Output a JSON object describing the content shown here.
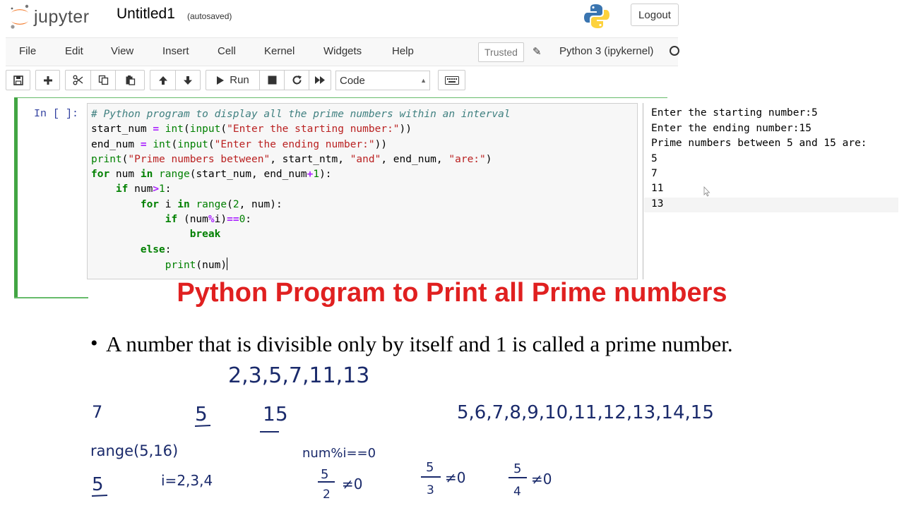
{
  "header": {
    "logo_text": "jupyter",
    "notebook_title": "Untitled1",
    "autosave_status": "(autosaved)",
    "logout_label": "Logout"
  },
  "menubar": {
    "items": [
      "File",
      "Edit",
      "View",
      "Insert",
      "Cell",
      "Kernel",
      "Widgets",
      "Help"
    ],
    "trusted_label": "Trusted",
    "kernel_name": "Python 3 (ipykernel)"
  },
  "toolbar": {
    "run_label": "Run",
    "cell_type": "Code"
  },
  "cell": {
    "prompt": "In [ ]:",
    "code_lines": [
      "# Python program to display all the prime numbers within an interval",
      "start_num = int(input(\"Enter the starting number:\"))",
      "end_num = int(input(\"Enter the ending number:\"))",
      "print(\"Prime numbers between\", start_ntm, \"and\", end_num, \"are:\")",
      "for num in range(start_num, end_num+1):",
      "    if num>1:",
      "        for i in range(2, num):",
      "            if (num%i)==0:",
      "                break",
      "        else:",
      "            print(num)"
    ]
  },
  "console_output": {
    "lines": [
      "Enter the starting number:5",
      "Enter the ending number:15",
      "Prime numbers between 5 and 15 are:",
      "5",
      "7",
      "11",
      "13"
    ]
  },
  "slide": {
    "title": "Python Program to Print all Prime numbers",
    "bullet": "A number that is divisible only by itself and 1 is called a prime number."
  },
  "handwriting": {
    "primes": "2,3,5,7,11,13",
    "seven": "7",
    "start": "5",
    "end": "15",
    "sequence": "5,6,7,8,9,10,11,12,13,14,15",
    "range_call": "range(5,16)",
    "condition": "num%i==0",
    "num5": "5",
    "i_values": "i=2,3,4",
    "frac1_num": "5",
    "frac1_den": "2",
    "frac1_rel": "≠0",
    "frac2_num": "5",
    "frac2_den": "3",
    "frac2_rel": "≠0",
    "frac3_num": "5",
    "frac3_den": "4",
    "frac3_rel": "≠0"
  },
  "colors": {
    "title_red": "#e02020",
    "cell_green": "#42a543",
    "ink_blue": "#1a2a6b"
  }
}
